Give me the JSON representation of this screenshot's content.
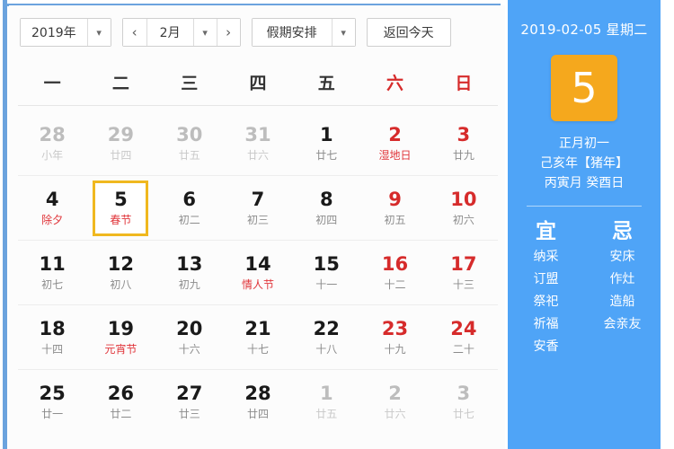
{
  "toolbar": {
    "year_label": "2019年",
    "year_caret": "▾",
    "prev_month": "‹",
    "month_label": "2月",
    "month_caret": "▾",
    "next_month": "›",
    "holiday_label": "假期安排",
    "holiday_caret": "▾",
    "today_button": "返回今天"
  },
  "weekdays": [
    {
      "label": "一",
      "weekend": false
    },
    {
      "label": "二",
      "weekend": false
    },
    {
      "label": "三",
      "weekend": false
    },
    {
      "label": "四",
      "weekend": false
    },
    {
      "label": "五",
      "weekend": false
    },
    {
      "label": "六",
      "weekend": true
    },
    {
      "label": "日",
      "weekend": true
    }
  ],
  "weeks": [
    [
      {
        "day": "28",
        "sub": "小年",
        "out": true,
        "red": false,
        "festival": false,
        "selected": false
      },
      {
        "day": "29",
        "sub": "廿四",
        "out": true,
        "red": false,
        "festival": false,
        "selected": false
      },
      {
        "day": "30",
        "sub": "廿五",
        "out": true,
        "red": false,
        "festival": false,
        "selected": false
      },
      {
        "day": "31",
        "sub": "廿六",
        "out": true,
        "red": false,
        "festival": false,
        "selected": false
      },
      {
        "day": "1",
        "sub": "廿七",
        "out": false,
        "red": false,
        "festival": false,
        "selected": false
      },
      {
        "day": "2",
        "sub": "湿地日",
        "out": false,
        "red": true,
        "festival": true,
        "selected": false
      },
      {
        "day": "3",
        "sub": "廿九",
        "out": false,
        "red": true,
        "festival": false,
        "selected": false
      }
    ],
    [
      {
        "day": "4",
        "sub": "除夕",
        "out": false,
        "red": false,
        "festival": true,
        "selected": false
      },
      {
        "day": "5",
        "sub": "春节",
        "out": false,
        "red": false,
        "festival": true,
        "selected": true
      },
      {
        "day": "6",
        "sub": "初二",
        "out": false,
        "red": false,
        "festival": false,
        "selected": false
      },
      {
        "day": "7",
        "sub": "初三",
        "out": false,
        "red": false,
        "festival": false,
        "selected": false
      },
      {
        "day": "8",
        "sub": "初四",
        "out": false,
        "red": false,
        "festival": false,
        "selected": false
      },
      {
        "day": "9",
        "sub": "初五",
        "out": false,
        "red": true,
        "festival": false,
        "selected": false
      },
      {
        "day": "10",
        "sub": "初六",
        "out": false,
        "red": true,
        "festival": false,
        "selected": false
      }
    ],
    [
      {
        "day": "11",
        "sub": "初七",
        "out": false,
        "red": false,
        "festival": false,
        "selected": false
      },
      {
        "day": "12",
        "sub": "初八",
        "out": false,
        "red": false,
        "festival": false,
        "selected": false
      },
      {
        "day": "13",
        "sub": "初九",
        "out": false,
        "red": false,
        "festival": false,
        "selected": false
      },
      {
        "day": "14",
        "sub": "情人节",
        "out": false,
        "red": false,
        "festival": true,
        "selected": false
      },
      {
        "day": "15",
        "sub": "十一",
        "out": false,
        "red": false,
        "festival": false,
        "selected": false
      },
      {
        "day": "16",
        "sub": "十二",
        "out": false,
        "red": true,
        "festival": false,
        "selected": false
      },
      {
        "day": "17",
        "sub": "十三",
        "out": false,
        "red": true,
        "festival": false,
        "selected": false
      }
    ],
    [
      {
        "day": "18",
        "sub": "十四",
        "out": false,
        "red": false,
        "festival": false,
        "selected": false
      },
      {
        "day": "19",
        "sub": "元宵节",
        "out": false,
        "red": false,
        "festival": true,
        "selected": false
      },
      {
        "day": "20",
        "sub": "十六",
        "out": false,
        "red": false,
        "festival": false,
        "selected": false
      },
      {
        "day": "21",
        "sub": "十七",
        "out": false,
        "red": false,
        "festival": false,
        "selected": false
      },
      {
        "day": "22",
        "sub": "十八",
        "out": false,
        "red": false,
        "festival": false,
        "selected": false
      },
      {
        "day": "23",
        "sub": "十九",
        "out": false,
        "red": true,
        "festival": false,
        "selected": false
      },
      {
        "day": "24",
        "sub": "二十",
        "out": false,
        "red": true,
        "festival": false,
        "selected": false
      }
    ],
    [
      {
        "day": "25",
        "sub": "廿一",
        "out": false,
        "red": false,
        "festival": false,
        "selected": false
      },
      {
        "day": "26",
        "sub": "廿二",
        "out": false,
        "red": false,
        "festival": false,
        "selected": false
      },
      {
        "day": "27",
        "sub": "廿三",
        "out": false,
        "red": false,
        "festival": false,
        "selected": false
      },
      {
        "day": "28",
        "sub": "廿四",
        "out": false,
        "red": false,
        "festival": false,
        "selected": false
      },
      {
        "day": "1",
        "sub": "廿五",
        "out": true,
        "red": false,
        "festival": false,
        "selected": false
      },
      {
        "day": "2",
        "sub": "廿六",
        "out": true,
        "red": false,
        "festival": false,
        "selected": false
      },
      {
        "day": "3",
        "sub": "廿七",
        "out": true,
        "red": false,
        "festival": false,
        "selected": false
      }
    ]
  ],
  "sidebar": {
    "date_line": "2019-02-05 星期二",
    "day_number": "5",
    "lunar_day": "正月初一",
    "lunar_year": "己亥年【猪年】",
    "ganzhi": "丙寅月 癸酉日",
    "yi": {
      "header": "宜",
      "items": [
        "纳采",
        "订盟",
        "祭祀",
        "祈福",
        "安香"
      ]
    },
    "ji": {
      "header": "忌",
      "items": [
        "安床",
        "作灶",
        "造船",
        "会亲友"
      ]
    }
  },
  "colors": {
    "sidebar_blue": "#4fa4f7",
    "tile_orange": "#f5a81d",
    "selection_border": "#f0b81f",
    "weekend_red": "#d62b2b",
    "festival_red": "#e0353a"
  }
}
